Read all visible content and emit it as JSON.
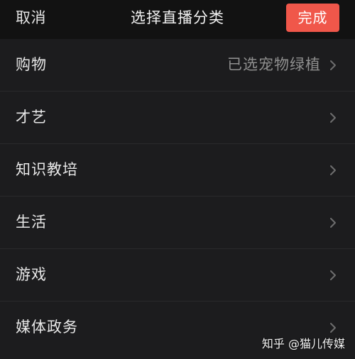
{
  "header": {
    "cancel_label": "取消",
    "title": "选择直播分类",
    "done_label": "完成"
  },
  "categories": [
    {
      "label": "购物",
      "selected_value": "已选宠物绿植"
    },
    {
      "label": "才艺"
    },
    {
      "label": "知识教培"
    },
    {
      "label": "生活"
    },
    {
      "label": "游戏"
    },
    {
      "label": "媒体政务"
    }
  ],
  "watermark": "知乎 @猫儿传媒",
  "colors": {
    "background": "#121212",
    "list_background": "#1c1c1e",
    "done_button": "#f0574a",
    "divider": "#2a2a2c"
  },
  "icons": [
    "chevron-right-icon"
  ]
}
